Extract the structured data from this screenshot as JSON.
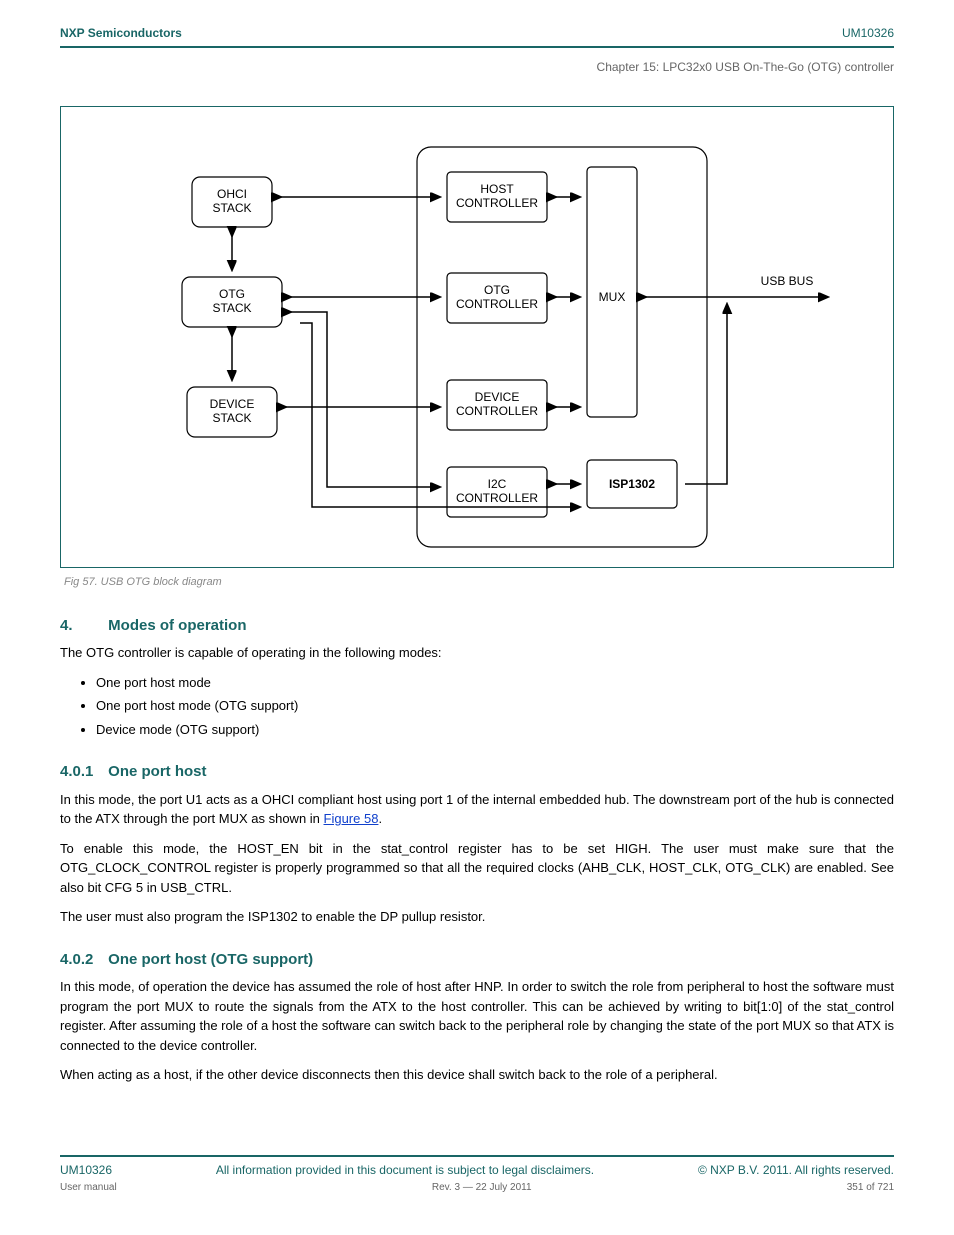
{
  "header": {
    "company": "NXP Semiconductors",
    "doc": "UM10326",
    "chapter": "Chapter 15: LPC32x0 USB On-The-Go (OTG) controller"
  },
  "figure": {
    "blocks": {
      "ohci": "OHCI\nSTACK",
      "otgstack": "OTG\nSTACK",
      "devstack": "DEVICE\nSTACK",
      "host": "HOST\nCONTROLLER",
      "otgctrl": "OTG\nCONTROLLER",
      "devctrl": "DEVICE\nCONTROLLER",
      "i2c": "I2C\nCONTROLLER",
      "mux": "MUX",
      "isp": "ISP1302",
      "usbbus": "USB BUS"
    },
    "caption": "Fig 57.  USB OTG block diagram"
  },
  "s4": {
    "num": "4.",
    "title": "Modes of operation",
    "body": "The OTG controller is capable of operating in the following modes:",
    "items": [
      "One port host mode",
      "One port host mode (OTG support)",
      "Device mode (OTG support)"
    ]
  },
  "s4_0_1": {
    "num": "4.0.1",
    "title": "One port host",
    "body1_pre": "In this mode, the port U1 acts as a OHCI compliant host using port 1 of the internal embedded hub. The downstream port of the hub is connected to the ATX through the port MUX as shown in ",
    "link": "Figure 58",
    "body1_post": ".",
    "body2": "To enable this mode, the HOST_EN bit in the stat_control register has to be set HIGH. The user must make sure that the OTG_CLOCK_CONTROL register is properly programmed so that all the required clocks (AHB_CLK, HOST_CLK, OTG_CLK) are enabled. See also bit CFG 5 in USB_CTRL.",
    "body3": "The user must also program the ISP1302 to enable the DP pullup resistor."
  },
  "s4_0_2": {
    "num": "4.0.2",
    "title": "One port host (OTG support)",
    "body1": "In this mode, of operation the device has assumed the role of host after HNP. In order to switch the role from peripheral to host the software must program the port MUX to route the signals from the ATX to the host controller. This can be achieved by writing to bit[1:0] of the stat_control register. After assuming the role of a host the software can switch back to the peripheral role by changing the state of the port MUX so that ATX is connected to the device controller.",
    "body2": "When acting as a host, if the other device disconnects then this device shall switch back to the role of a peripheral."
  },
  "footer": {
    "doc": "UM10326",
    "disclaimer": "All information provided in this document is subject to legal disclaimers.",
    "copyright": "© NXP B.V. 2011. All rights reserved.",
    "manual": "User manual",
    "rev": "Rev. 3 — 22 July 2011",
    "page": "351 of 721"
  }
}
